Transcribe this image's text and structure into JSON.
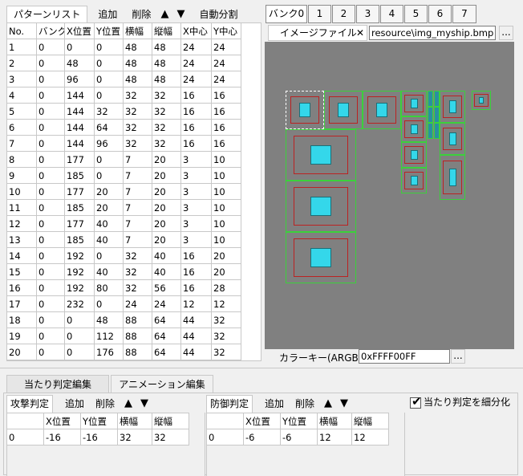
{
  "pattern_list": {
    "tab_label": "パターンリスト",
    "toolbar": {
      "add": "追加",
      "delete": "削除",
      "up": "▲",
      "down": "▼",
      "auto_split": "自動分割"
    },
    "columns": [
      "No.",
      "バンク",
      "X位置",
      "Y位置",
      "横幅",
      "縦幅",
      "X中心",
      "Y中心"
    ],
    "rows": [
      [
        "1",
        "0",
        "0",
        "0",
        "48",
        "48",
        "24",
        "24"
      ],
      [
        "2",
        "0",
        "48",
        "0",
        "48",
        "48",
        "24",
        "24"
      ],
      [
        "3",
        "0",
        "96",
        "0",
        "48",
        "48",
        "24",
        "24"
      ],
      [
        "4",
        "0",
        "144",
        "0",
        "32",
        "32",
        "16",
        "16"
      ],
      [
        "5",
        "0",
        "144",
        "32",
        "32",
        "32",
        "16",
        "16"
      ],
      [
        "6",
        "0",
        "144",
        "64",
        "32",
        "32",
        "16",
        "16"
      ],
      [
        "7",
        "0",
        "144",
        "96",
        "32",
        "32",
        "16",
        "16"
      ],
      [
        "8",
        "0",
        "177",
        "0",
        "7",
        "20",
        "3",
        "10"
      ],
      [
        "9",
        "0",
        "185",
        "0",
        "7",
        "20",
        "3",
        "10"
      ],
      [
        "10",
        "0",
        "177",
        "20",
        "7",
        "20",
        "3",
        "10"
      ],
      [
        "11",
        "0",
        "185",
        "20",
        "7",
        "20",
        "3",
        "10"
      ],
      [
        "12",
        "0",
        "177",
        "40",
        "7",
        "20",
        "3",
        "10"
      ],
      [
        "13",
        "0",
        "185",
        "40",
        "7",
        "20",
        "3",
        "10"
      ],
      [
        "14",
        "0",
        "192",
        "0",
        "32",
        "40",
        "16",
        "20"
      ],
      [
        "15",
        "0",
        "192",
        "40",
        "32",
        "40",
        "16",
        "20"
      ],
      [
        "16",
        "0",
        "192",
        "80",
        "32",
        "56",
        "16",
        "28"
      ],
      [
        "17",
        "0",
        "232",
        "0",
        "24",
        "24",
        "12",
        "12"
      ],
      [
        "18",
        "0",
        "0",
        "48",
        "88",
        "64",
        "44",
        "32"
      ],
      [
        "19",
        "0",
        "0",
        "112",
        "88",
        "64",
        "44",
        "32"
      ],
      [
        "20",
        "0",
        "0",
        "176",
        "88",
        "64",
        "44",
        "32"
      ]
    ]
  },
  "banks": {
    "tabs": [
      "バンク0",
      "1",
      "2",
      "3",
      "4",
      "5",
      "6",
      "7"
    ],
    "image_file_label": "イメージファイル",
    "image_path": "resource\\img_myship.bmp",
    "browse": "...",
    "color_key_label": "カラーキー(ARGB)",
    "color_key_value": "0xFFFF00FF"
  },
  "bottom_tabs": [
    "当たり判定編集",
    "アニメーション編集"
  ],
  "attack": {
    "label": "攻撃判定",
    "add": "追加",
    "delete": "削除",
    "up": "▲",
    "down": "▼",
    "columns": [
      "",
      "X位置",
      "Y位置",
      "横幅",
      "縦幅"
    ],
    "rows": [
      [
        "0",
        "-16",
        "-16",
        "32",
        "32"
      ]
    ]
  },
  "defense": {
    "label": "防御判定",
    "add": "追加",
    "delete": "削除",
    "up": "▲",
    "down": "▼",
    "columns": [
      "",
      "X位置",
      "Y位置",
      "横幅",
      "縦幅"
    ],
    "rows": [
      [
        "0",
        "-6",
        "-6",
        "12",
        "12"
      ]
    ]
  },
  "subdivide_label": "当たり判定を細分化",
  "subdivide_checked": true
}
